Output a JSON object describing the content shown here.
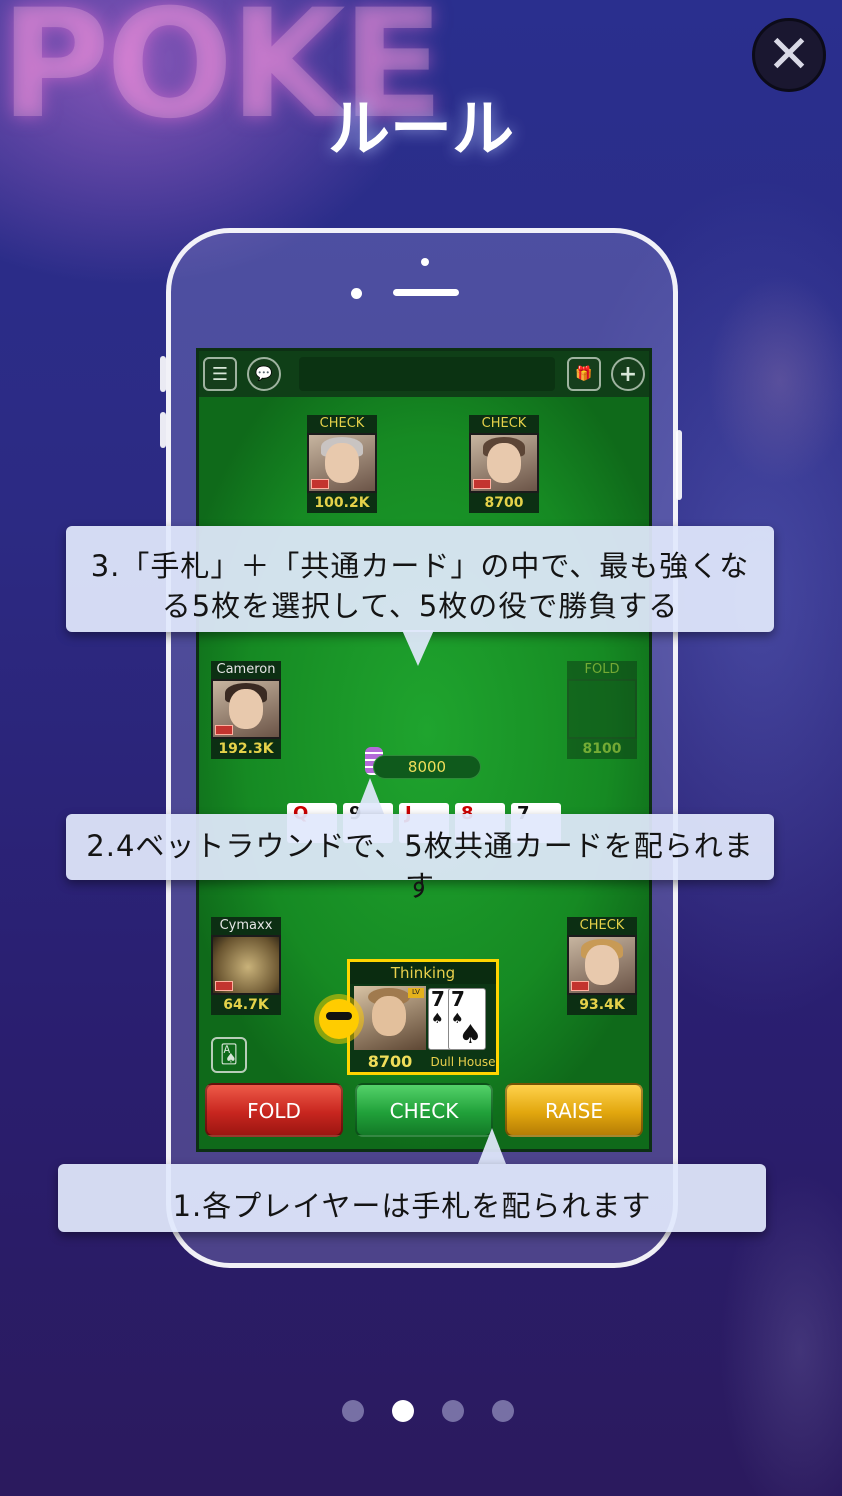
{
  "page": {
    "title": "ルール",
    "bg_logo_text": "POKE"
  },
  "close_button": {
    "symbol": "✕"
  },
  "game": {
    "topbar": {
      "menu_icon": "☰",
      "chat_icon": "💬",
      "gift_icon": "🎁",
      "add_icon": "+"
    },
    "seats": [
      {
        "label": "CHECK",
        "chips": "100.2K"
      },
      {
        "label": "CHECK",
        "chips": "8700"
      },
      {
        "label": "Cameron",
        "chips": "192.3K"
      },
      {
        "label": "FOLD",
        "chips": "8100"
      },
      {
        "label": "Cymaxx",
        "chips": "64.7K"
      },
      {
        "label": "CHECK",
        "chips": "93.4K"
      }
    ],
    "pot": "8000",
    "board_cards": [
      "Q",
      "9",
      "J",
      "8",
      "7"
    ],
    "hero": {
      "status": "Thinking",
      "chips": "8700",
      "hand_name": "Dull House",
      "cards": [
        {
          "rank": "7",
          "suit": "♠"
        },
        {
          "rank": "7",
          "suit": "♠"
        }
      ]
    },
    "actions": {
      "fold": "FOLD",
      "check": "CHECK",
      "raise": "RAISE"
    }
  },
  "tips": {
    "tip3_line1": "3.「手札」＋「共通カード」の中で、最も強くな",
    "tip3_line2": "る5枚を選択して、5枚の役で勝負する",
    "tip2": "2.4ベットラウンドで、5枚共通カードを配られます",
    "tip1": "1.各プレイヤーは手札を配られます"
  },
  "pagination": {
    "count": 4,
    "active_index": 1
  }
}
